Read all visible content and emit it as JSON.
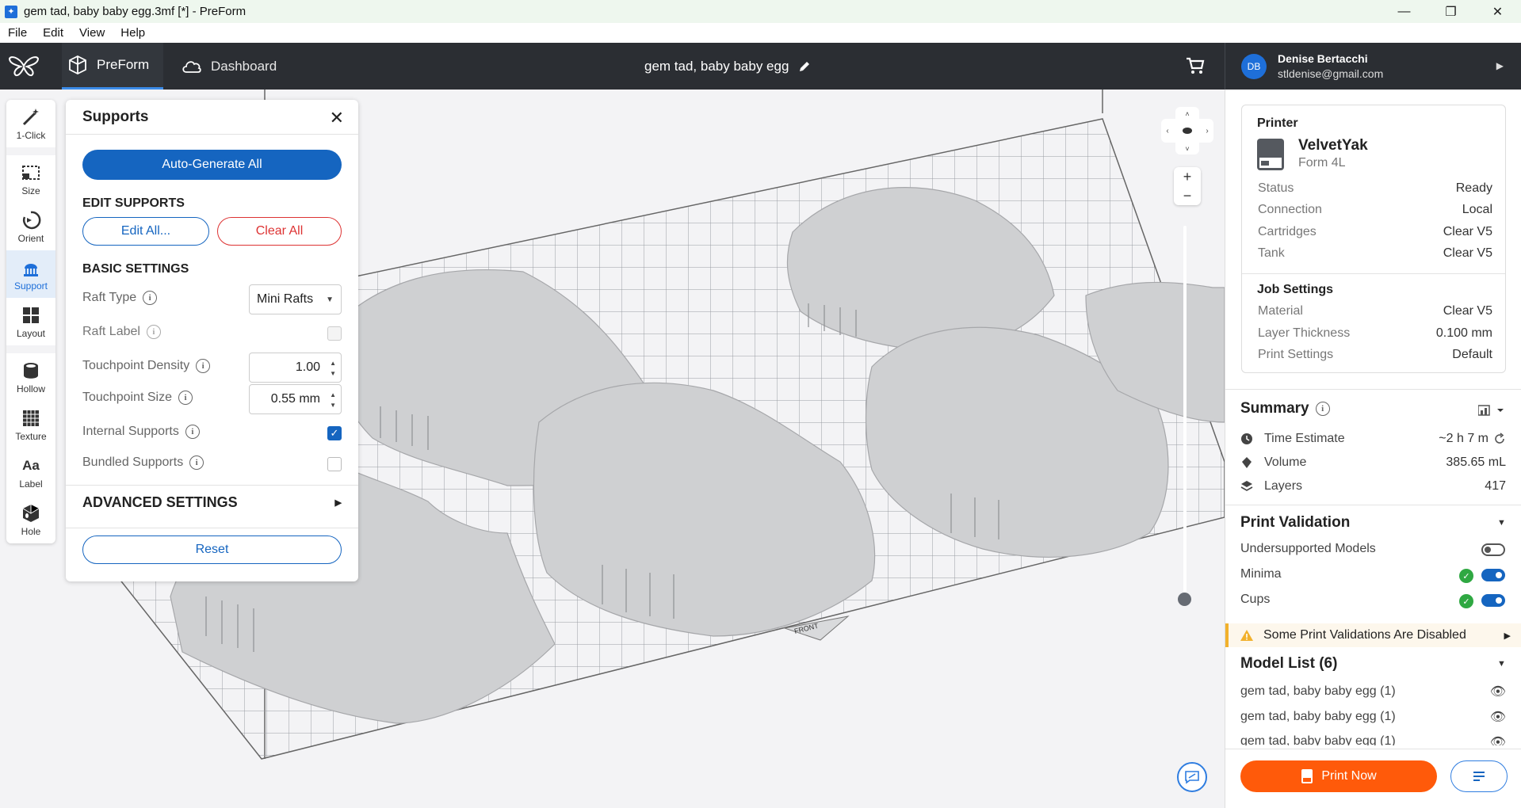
{
  "window": {
    "title": "gem tad, baby baby egg.3mf [*] - PreForm",
    "controls": [
      "—",
      "❐",
      "✕"
    ]
  },
  "menu": [
    "File",
    "Edit",
    "View",
    "Help"
  ],
  "header": {
    "tabs": [
      {
        "label": "PreForm",
        "icon": "preform-icon"
      },
      {
        "label": "Dashboard",
        "icon": "cloud-icon"
      }
    ],
    "job_title": "gem tad, baby baby egg",
    "user": {
      "initials": "DB",
      "name": "Denise Bertacchi",
      "email": "stldenise@gmail.com"
    }
  },
  "toolbar": [
    {
      "label": "1-Click",
      "icon": "magic-wand-icon"
    },
    {
      "label": "Size",
      "icon": "resize-icon"
    },
    {
      "label": "Orient",
      "icon": "orient-icon"
    },
    {
      "label": "Support",
      "icon": "support-icon",
      "active": true
    },
    {
      "label": "Layout",
      "icon": "layout-icon"
    },
    {
      "label": "Hollow",
      "icon": "hollow-icon"
    },
    {
      "label": "Texture",
      "icon": "texture-icon"
    },
    {
      "label": "Label",
      "icon": "label-icon",
      "glyph": "Aa"
    },
    {
      "label": "Hole",
      "icon": "hole-icon"
    }
  ],
  "supports": {
    "title": "Supports",
    "auto_generate": "Auto-Generate All",
    "edit_section": "EDIT SUPPORTS",
    "edit_all": "Edit All...",
    "clear_all": "Clear All",
    "basic_section": "BASIC SETTINGS",
    "raft_type_label": "Raft Type",
    "raft_type_value": "Mini Rafts",
    "raft_label_label": "Raft Label",
    "touchpoint_density_label": "Touchpoint Density",
    "touchpoint_density_value": "1.00",
    "touchpoint_size_label": "Touchpoint Size",
    "touchpoint_size_value": "0.55 mm",
    "internal_supports_label": "Internal Supports",
    "internal_supports_checked": true,
    "bundled_supports_label": "Bundled Supports",
    "bundled_supports_checked": false,
    "advanced_section": "ADVANCED SETTINGS",
    "reset": "Reset"
  },
  "viewport": {
    "plate_label": "FRONT"
  },
  "printer": {
    "heading": "Printer",
    "name": "VelvetYak",
    "model": "Form 4L",
    "status_rows": [
      {
        "k": "Status",
        "v": "Ready"
      },
      {
        "k": "Connection",
        "v": "Local"
      },
      {
        "k": "Cartridges",
        "v": "Clear V5"
      },
      {
        "k": "Tank",
        "v": "Clear V5"
      }
    ],
    "job_heading": "Job Settings",
    "job_rows": [
      {
        "k": "Material",
        "v": "Clear V5"
      },
      {
        "k": "Layer Thickness",
        "v": "0.100 mm"
      },
      {
        "k": "Print Settings",
        "v": "Default"
      }
    ]
  },
  "summary": {
    "heading": "Summary",
    "time_label": "Time Estimate",
    "time_value": "~2 h 7 m",
    "volume_label": "Volume",
    "volume_value": "385.65 mL",
    "layers_label": "Layers",
    "layers_value": "417"
  },
  "validation": {
    "heading": "Print Validation",
    "items": [
      {
        "label": "Undersupported Models",
        "enabled": false,
        "passed": null
      },
      {
        "label": "Minima",
        "enabled": true,
        "passed": true
      },
      {
        "label": "Cups",
        "enabled": true,
        "passed": true
      }
    ],
    "warning": "Some Print Validations Are Disabled"
  },
  "models": {
    "heading": "Model List (6)",
    "items": [
      "gem tad, baby baby egg (1)",
      "gem tad, baby baby egg (1)",
      "gem tad, baby baby egg (1)"
    ]
  },
  "actions": {
    "print_now": "Print Now"
  },
  "colors": {
    "accent": "#1565c0",
    "header_bg": "#2b2e33",
    "print_orange": "#ff5a0a",
    "ok_green": "#2fa842",
    "warn_yellow": "#f2b12c"
  }
}
